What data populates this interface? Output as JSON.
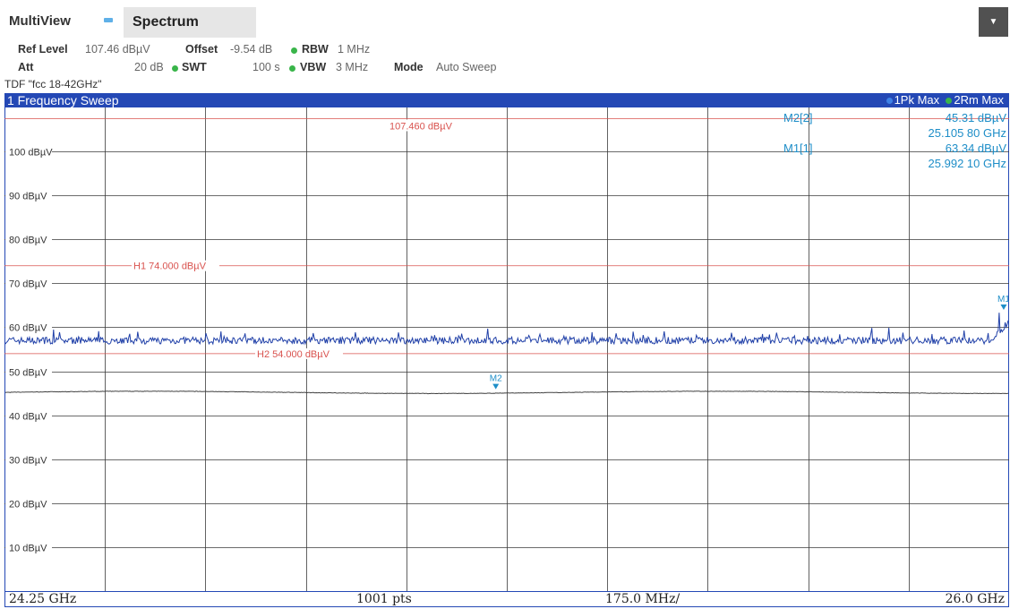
{
  "tabs": {
    "multiview": "MultiView",
    "spectrum": "Spectrum"
  },
  "menu_icon": "dropdown-arrow-icon",
  "settings": {
    "ref_level_label": "Ref Level",
    "ref_level_value": "107.46 dBµV",
    "offset_label": "Offset",
    "offset_value": "-9.54 dB",
    "rbw_label": "RBW",
    "rbw_value": "1 MHz",
    "att_label": "Att",
    "att_value": "20 dB",
    "swt_label": "SWT",
    "swt_value": "100 s",
    "vbw_label": "VBW",
    "vbw_value": "3 MHz",
    "mode_label": "Mode",
    "mode_value": "Auto Sweep",
    "tdf": "TDF \"fcc 18-42GHz\""
  },
  "window": {
    "title": "1 Frequency Sweep",
    "legend": [
      "1Pk Max",
      "2Rm Max"
    ]
  },
  "colors": {
    "window_blue": "#2448b5",
    "trace_pk_max": "#2040a8",
    "trace_rm_max": "#404040",
    "limit_lines": "#d9534f",
    "marker": "#1e8ec8",
    "status_dot": "#39b54a"
  },
  "marker_table": [
    {
      "label": "M2[2]",
      "level": "45.31 dBµV",
      "freq": "25.105 80 GHz"
    },
    {
      "label": "M1[1]",
      "level": "63.34 dBµV",
      "freq": "25.992 10 GHz"
    }
  ],
  "footer": {
    "start": "24.25 GHz",
    "points": "1001 pts",
    "span": "175.0 MHz/",
    "stop": "26.0 GHz"
  },
  "chart_data": {
    "type": "line",
    "x_range_ghz": [
      24.25,
      26.0
    ],
    "y_range_dbuv": [
      0,
      110
    ],
    "y_tick_labels": [
      "100 dBµV",
      "90 dBµV",
      "80 dBµV",
      "70 dBµV",
      "60 dBµV",
      "50 dBµV",
      "40 dBµV",
      "30 dBµV",
      "20 dBµV",
      "10 dBµV"
    ],
    "y_tick_values": [
      100,
      90,
      80,
      70,
      60,
      50,
      40,
      30,
      20,
      10
    ],
    "grid": true,
    "ref_level": {
      "label": "107.460 dBµV",
      "value": 107.46
    },
    "limit_lines": [
      {
        "label": "H1 74.000 dBµV",
        "value": 74.0
      },
      {
        "label": "H2 54.000 dBµV",
        "value": 54.0
      }
    ],
    "series": [
      {
        "name": "1Pk Max",
        "approx_level": 57,
        "noise": 0.8,
        "end_peak": {
          "x": 25.9921,
          "y": 63.34
        }
      },
      {
        "name": "2Rm Max",
        "approx_level": 45.2,
        "noise": 0.1
      }
    ],
    "markers": [
      {
        "label": "M2",
        "x": 25.1058,
        "y": 45.31
      },
      {
        "label": "M1",
        "x": 25.9921,
        "y": 63.34
      }
    ]
  }
}
